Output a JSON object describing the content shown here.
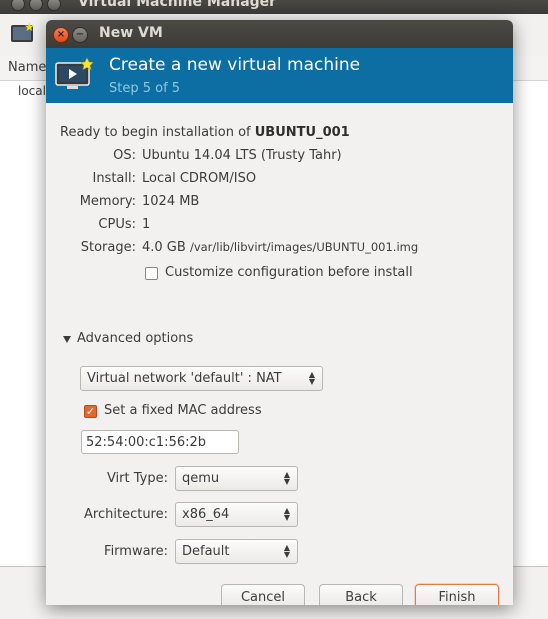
{
  "background_window": {
    "title": "Virtual Machine Manager",
    "column_header": "Name",
    "row_label": "localhost (QEMU)"
  },
  "dialog": {
    "title": "New VM",
    "banner_title": "Create a new virtual machine",
    "banner_step": "Step 5 of 5",
    "ready_prefix": "Ready to begin installation of",
    "vm_name": "UBUNTU_001",
    "details": {
      "os_label": "OS:",
      "os_value": "Ubuntu 14.04 LTS (Trusty Tahr)",
      "install_label": "Install:",
      "install_value": "Local CDROM/ISO",
      "memory_label": "Memory:",
      "memory_value": "1024 MB",
      "cpus_label": "CPUs:",
      "cpus_value": "1",
      "storage_label": "Storage:",
      "storage_size": "4.0 GB",
      "storage_path": "/var/lib/libvirt/images/UBUNTU_001.img"
    },
    "customize_label": "Customize configuration before install",
    "customize_checked": false,
    "advanced": {
      "expander_label": "Advanced options",
      "network": "Virtual network 'default' : NAT",
      "fixed_mac_label": "Set a fixed MAC address",
      "fixed_mac_checked": true,
      "mac_value": "52:54:00:c1:56:2b",
      "virt_type_label": "Virt Type:",
      "virt_type_value": "qemu",
      "architecture_label": "Architecture:",
      "architecture_value": "x86_64",
      "firmware_label": "Firmware:",
      "firmware_value": "Default"
    },
    "buttons": {
      "cancel": "Cancel",
      "back": "Back",
      "finish": "Finish"
    }
  },
  "colors": {
    "banner": "#0c6ea3",
    "accent": "#e1682f",
    "titlebar": "#3c3b37"
  }
}
